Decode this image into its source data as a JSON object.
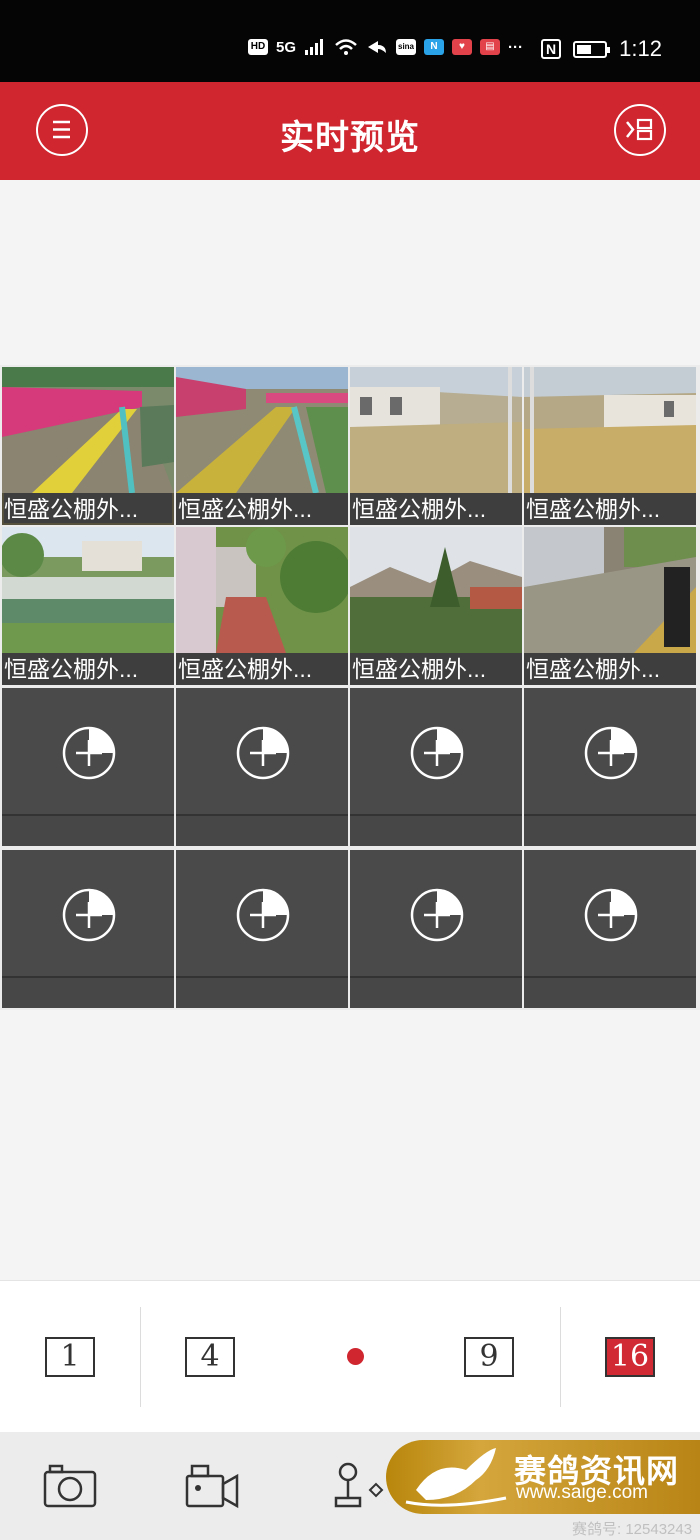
{
  "status_bar": {
    "hd": "HD",
    "signal": "5G",
    "app_badge_1": "sina",
    "app_badge_2": "N",
    "more": "···",
    "nfc": "N",
    "battery_level": 0.55,
    "time": "1:12"
  },
  "header": {
    "title": "实时预览",
    "left_icon": "menu-icon",
    "right_icon": "channel-list-icon",
    "bg_color": "#cf2630"
  },
  "cameras": [
    {
      "label": "恒盛公棚外...",
      "selected": true
    },
    {
      "label": "恒盛公棚外..."
    },
    {
      "label": "恒盛公棚外..."
    },
    {
      "label": "恒盛公棚外..."
    },
    {
      "label": "恒盛公棚外..."
    },
    {
      "label": "恒盛公棚外..."
    },
    {
      "label": "恒盛公棚外..."
    },
    {
      "label": "恒盛公棚外..."
    }
  ],
  "empty_slots": 8,
  "layout_options": {
    "one": "1",
    "four": "4",
    "nine": "9",
    "sixteen": "16",
    "active": "16"
  },
  "toolbar": {
    "items": [
      "camera-capture-icon",
      "video-record-icon",
      "ptz-joystick-icon"
    ]
  },
  "watermark": {
    "name": "赛鸽资讯网",
    "url": "www.saige.com",
    "footnote": "赛鸽号: 12543243"
  }
}
